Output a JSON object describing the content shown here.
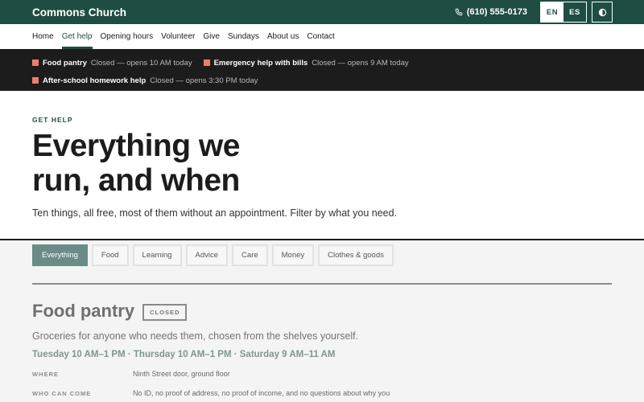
{
  "header": {
    "brand": "Commons Church",
    "phone": "(610) 555-0173",
    "lang_en": "EN",
    "lang_es": "ES",
    "accent": "#1f4d43"
  },
  "nav": {
    "items": [
      {
        "label": "Home"
      },
      {
        "label": "Get help"
      },
      {
        "label": "Opening hours"
      },
      {
        "label": "Volunteer"
      },
      {
        "label": "Give"
      },
      {
        "label": "Sundays"
      },
      {
        "label": "About us"
      },
      {
        "label": "Contact"
      }
    ],
    "current": "Get help"
  },
  "status": {
    "items": [
      {
        "name": "Food pantry",
        "state": "Closed — opens 10 AM today"
      },
      {
        "name": "Emergency help with bills",
        "state": "Closed — opens 9 AM today"
      },
      {
        "name": "After-school homework help",
        "state": "Closed — opens 3:30 PM today"
      }
    ],
    "marker_color": "#e9806c"
  },
  "hero": {
    "eyebrow": "GET HELP",
    "title": "Everything we run, and when",
    "subtitle": "Ten things, all free, most of them without an appointment. Filter by what you need."
  },
  "filters": {
    "chips": [
      "Everything",
      "Food",
      "Learning",
      "Advice",
      "Care",
      "Money",
      "Clothes & goods"
    ],
    "active": "Everything"
  },
  "service": {
    "title": "Food pantry",
    "badge": "CLOSED",
    "description": "Groceries for anyone who needs them, chosen from the shelves yourself.",
    "hours": "Tuesday 10 AM–1 PM · Thursday 10 AM–1 PM · Saturday 9 AM–11 AM",
    "where_label": "WHERE",
    "where_value": "Ninth Street door, ground floor",
    "who_label": "WHO CAN COME",
    "who_value": "No ID, no proof of address, no proof of income, and no questions about why you"
  }
}
